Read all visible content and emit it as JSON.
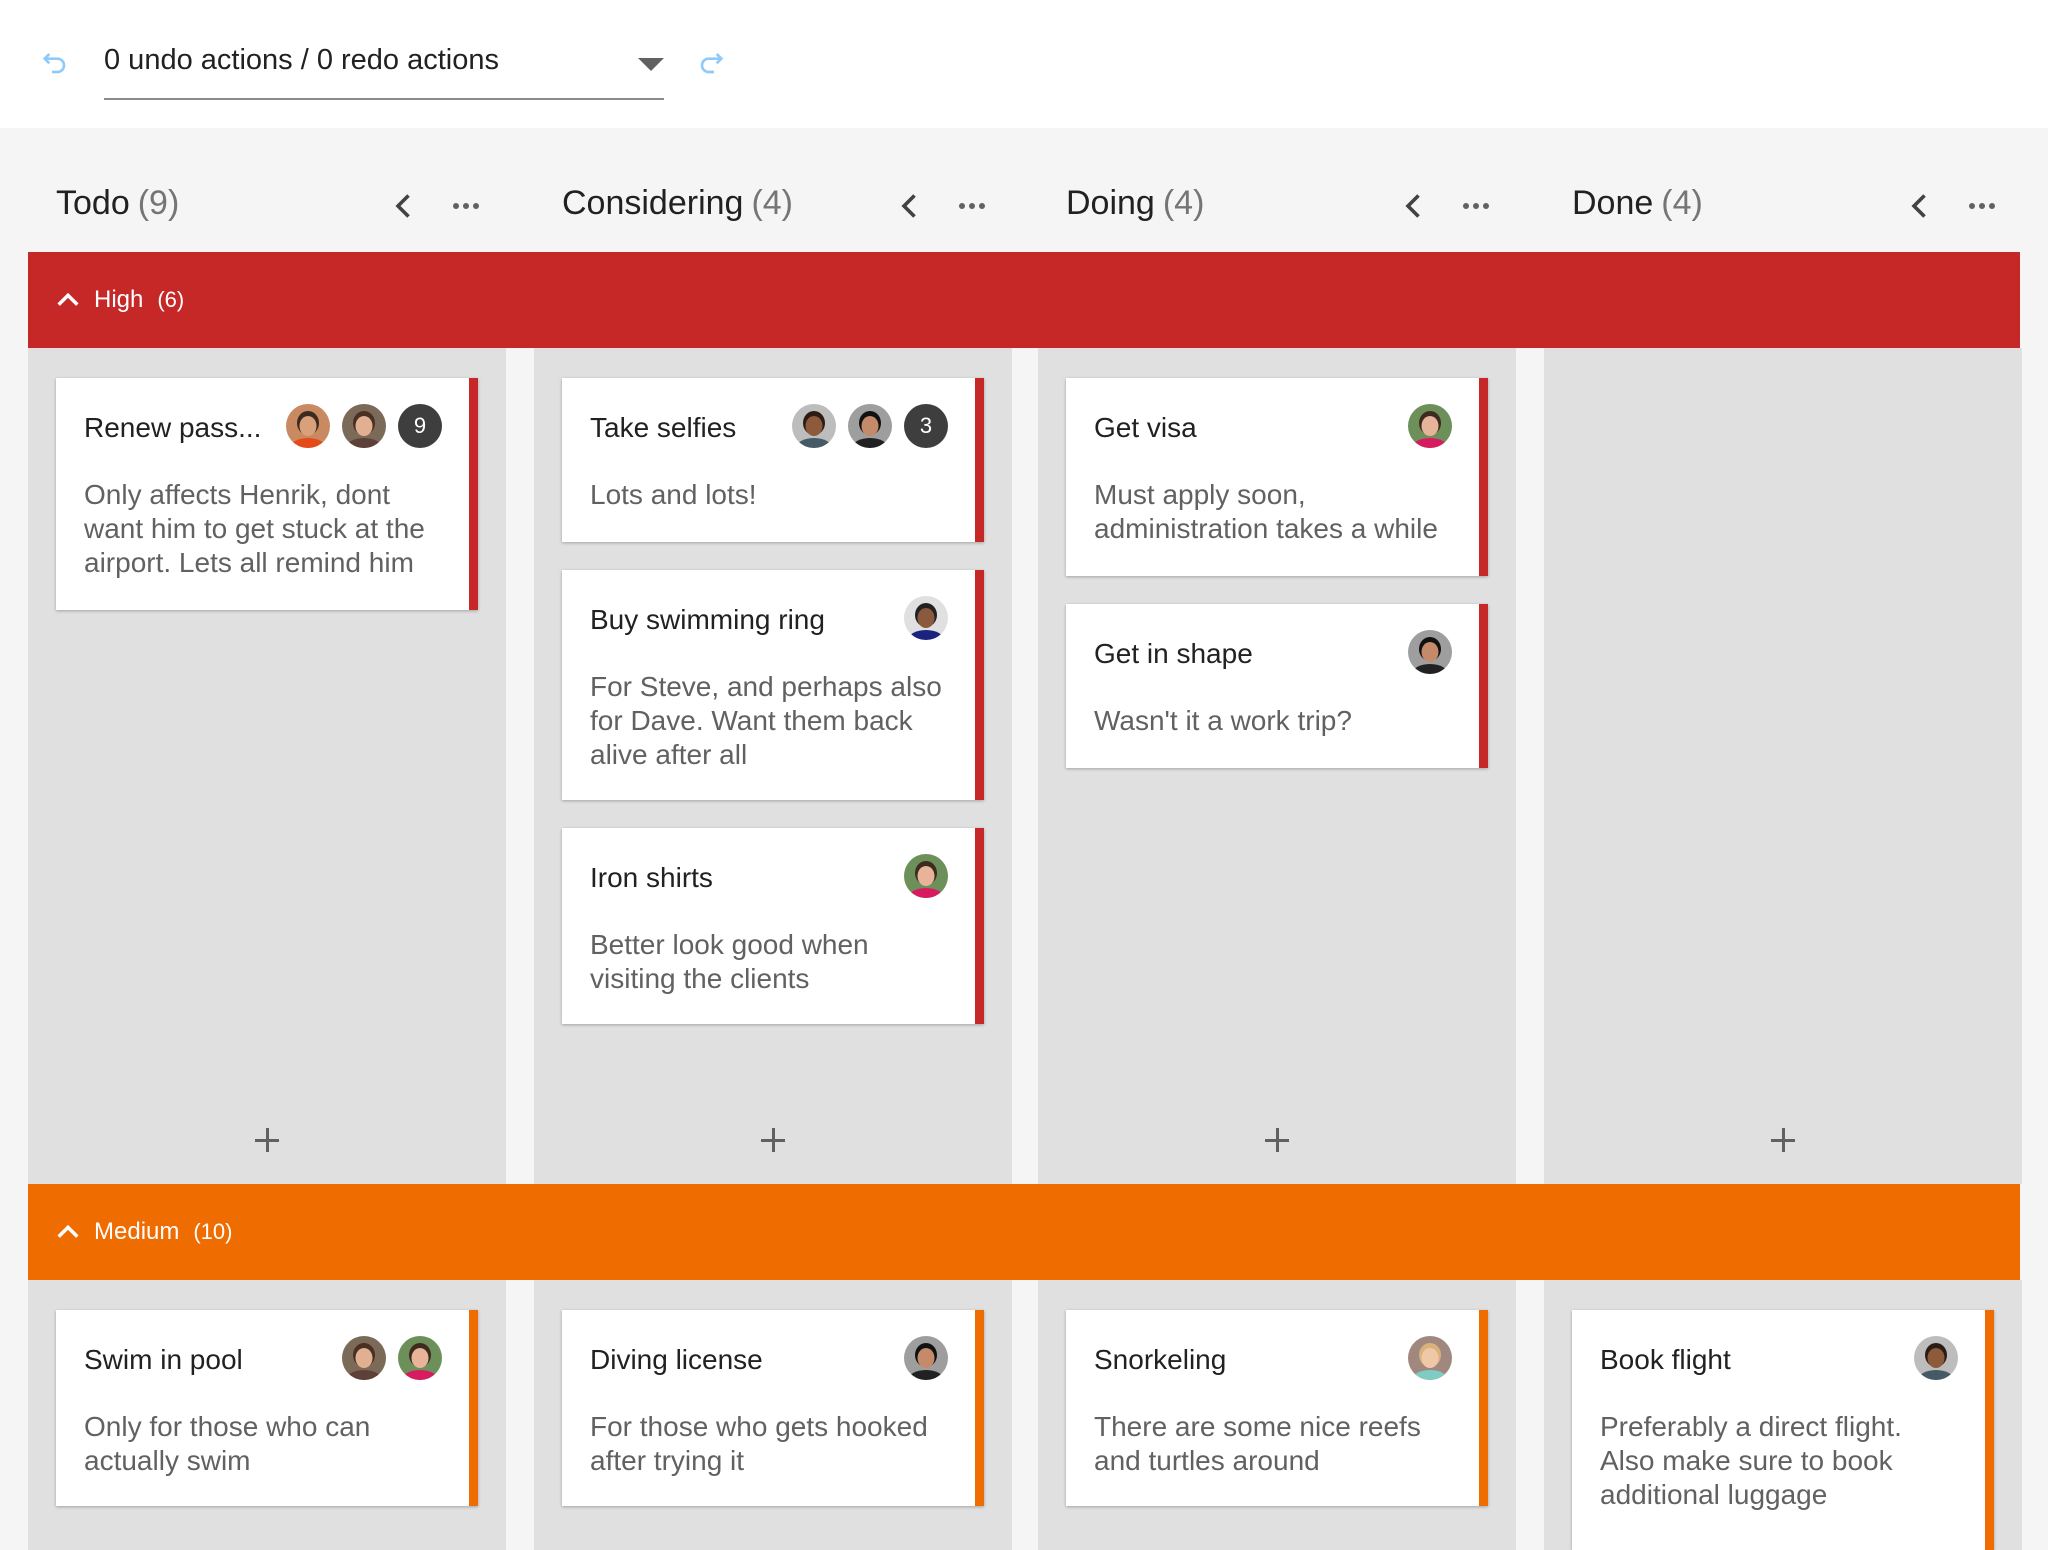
{
  "toolbar": {
    "undo_icon": "undo-icon",
    "redo_icon": "redo-icon",
    "history_value": "0 undo actions / 0 redo actions"
  },
  "columns": [
    {
      "title": "Todo",
      "count": "(9)"
    },
    {
      "title": "Considering",
      "count": "(4)"
    },
    {
      "title": "Doing",
      "count": "(4)"
    },
    {
      "title": "Done",
      "count": "(4)"
    }
  ],
  "lanes": [
    {
      "name": "High",
      "count": "(6)",
      "color": "#c62828",
      "cards": [
        [
          {
            "title": "Renew pass...",
            "desc": "Only affects Henrik, dont want him to get stuck at the airport. Lets all remind him",
            "avatars": [
              "a1",
              "a2"
            ],
            "more": "9"
          }
        ],
        [
          {
            "title": "Take selfies",
            "desc": "Lots and lots!",
            "avatars": [
              "a3",
              "a4"
            ],
            "more": "3"
          },
          {
            "title": "Buy swimming ring",
            "desc": "For Steve, and perhaps also for Dave. Want them back alive after all",
            "avatars": [
              "a5"
            ],
            "more": ""
          },
          {
            "title": "Iron shirts",
            "desc": "Better look good when visiting the clients",
            "avatars": [
              "a6"
            ],
            "more": ""
          }
        ],
        [
          {
            "title": "Get visa",
            "desc": "Must apply soon, administration takes a while",
            "avatars": [
              "a6"
            ],
            "more": ""
          },
          {
            "title": "Get in shape",
            "desc": "Wasn't it a work trip?",
            "avatars": [
              "a4"
            ],
            "more": ""
          }
        ],
        []
      ]
    },
    {
      "name": "Medium",
      "count": "(10)",
      "color": "#ef6c00",
      "cards": [
        [
          {
            "title": "Swim in pool",
            "desc": "Only for those who can actually swim",
            "avatars": [
              "a2",
              "a6"
            ],
            "more": ""
          }
        ],
        [
          {
            "title": "Diving license",
            "desc": "For those who gets hooked after trying it",
            "avatars": [
              "a4"
            ],
            "more": ""
          }
        ],
        [
          {
            "title": "Snorkeling",
            "desc": "There are some nice reefs and turtles around",
            "avatars": [
              "a7"
            ],
            "more": ""
          }
        ],
        [
          {
            "title": "Book flight",
            "desc": "Preferably a direct flight. Also make sure to book additional luggage",
            "avatars": [
              "a3"
            ],
            "more": ""
          }
        ]
      ]
    }
  ],
  "add_icon": "plus-icon",
  "collapse_icon": "chevron-left-icon",
  "more_icon": "more-horiz-icon",
  "lane_toggle_icon": "chevron-up-icon"
}
